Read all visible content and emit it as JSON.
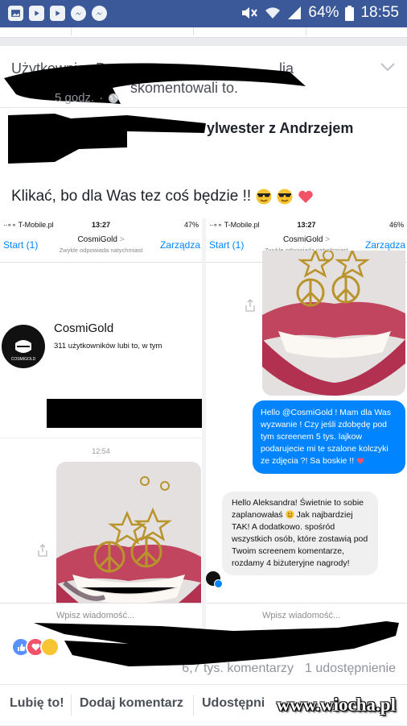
{
  "status_bar": {
    "battery": "64%",
    "time": "18:55"
  },
  "post": {
    "likers_line_1_visible": "Użytkownicy D",
    "likers_line_1_tail": "lia",
    "likers_line_2_tail": "skomentowali to.",
    "author_visible": "ylwester z Andrzejem",
    "time": "5 godz.",
    "time_separator": "·",
    "text": "Klikać, bo dla Was tez coś będzie !!"
  },
  "screenshot": {
    "left_phone": {
      "carrier": "∙∙∘∘ T-Mobile.pl",
      "clock": "13:27",
      "battery": "47%",
      "back": "Start (1)",
      "title": "CosmiGold",
      "chevron": ">",
      "subtitle": "Zwykle odpowiada natychmiast",
      "manage": "Zarządza",
      "page_name": "CosmiGold",
      "page_likes": "311 użytkowników lubi to, w tym",
      "logo_text": "COSMIGOLD",
      "timestamp": "12:54",
      "input_placeholder": "Wpisz wiadomość..."
    },
    "right_phone": {
      "carrier": "∙∙∘∘ T-Mobile.pl",
      "clock": "13:27",
      "battery": "46%",
      "back": "Start (1)",
      "title": "CosmiGold",
      "chevron": ">",
      "subtitle": "Zwykle odpowiada natychmiast",
      "manage": "Zarządza",
      "outgoing_message": "Hello @CosmiGold ! Mam dla Was wyzwanie ! Czy jeśli zdobędę pod tym screenem 5 tys. lajkow podarujecie mi te szalone kolczyki ze zdjęcia ?! Sa boskie !!",
      "incoming_message_1": "Hello Aleksandra! Świetnie to sobie zaplanowałaś",
      "incoming_message_2": "Jak najbardziej TAK! A dodatkowo. spośród wszystkich osób, które zostawią pod Twoim screenem komentarze, rozdamy 4 biżuteryjne nagrody!",
      "input_placeholder": "Wpisz wiadomość..."
    }
  },
  "footer": {
    "comments": "6,7 tys. komentarzy",
    "shares": "1 udostępnienie",
    "like_button": "Lubię to!",
    "comment_button": "Dodaj komentarz",
    "share_button": "Udostępni",
    "watermark": "www.wiocha.pl"
  },
  "colors": {
    "facebook_blue": "#3b5998",
    "messenger_blue": "#0084ff",
    "text_secondary": "#90949c"
  }
}
